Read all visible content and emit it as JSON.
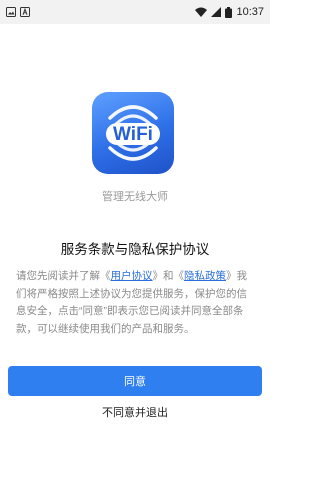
{
  "status_bar": {
    "time": "10:37",
    "left_icons": [
      "image-notification-icon",
      "a-notification-icon"
    ],
    "right_icons": [
      "wifi-icon",
      "cellular-icon",
      "battery-icon"
    ]
  },
  "app": {
    "name": "管理无线大师",
    "logo_text": "WiFi",
    "brand_color": "#2f7ff0"
  },
  "dialog": {
    "title": "服务条款与隐私保护协议",
    "body_prefix": "请您先阅读并了解《",
    "link_user_agreement": "用户协议",
    "body_middle": "》和《",
    "link_privacy_policy": "隐私政策",
    "body_suffix": "》我们将严格按照上述协议为您提供服务，保护您的信息安全，点击“同意”即表示您已阅读并同意全部条款，可以继续使用我们的产品和服务。",
    "agree_label": "同意",
    "disagree_label": "不同意并退出"
  }
}
